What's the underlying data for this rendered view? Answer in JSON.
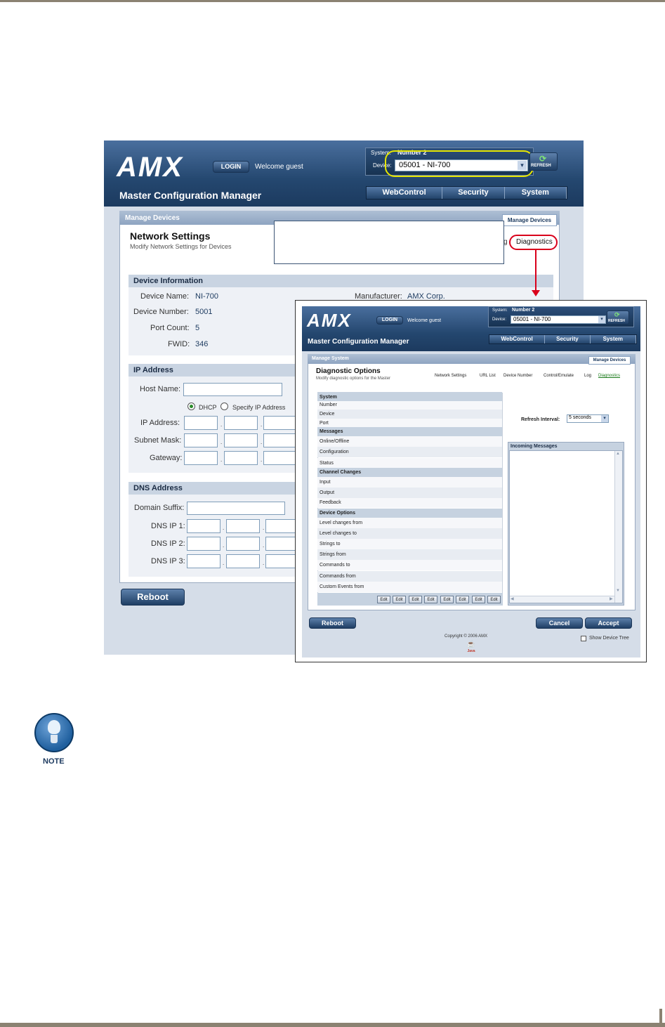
{
  "back": {
    "logo": "AMX",
    "login_label": "LOGIN",
    "welcome": "Welcome guest",
    "system_label": "System:",
    "system_value": "Number 2",
    "device_label": "Device:",
    "device_value": "05001 - NI-700",
    "refresh_label": "REFRESH",
    "app_title": "Master Configuration Manager",
    "tabs": [
      "WebControl",
      "Security",
      "System"
    ],
    "breadcrumb": "Manage Devices",
    "manage_tab": "Manage Devices",
    "page_title": "Network Settings",
    "page_subtitle": "Modify Network Settings for Devices",
    "nav_partial": "g",
    "nav_diagnostics": "Diagnostics",
    "device_info": {
      "section": "Device Information",
      "name_label": "Device Name:",
      "name": "NI-700",
      "number_label": "Device Number:",
      "number": "5001",
      "port_label": "Port Count:",
      "port": "5",
      "fwid_label": "FWID:",
      "fwid": "346",
      "mfr_label": "Manufacturer:",
      "mfr": "AMX Corp."
    },
    "ip": {
      "section": "IP Address",
      "host_label": "Host Name:",
      "dhcp": "DHCP",
      "specify": "Specify IP Address",
      "ip_label": "IP Address:",
      "subnet_label": "Subnet Mask:",
      "gateway_label": "Gateway:"
    },
    "dns": {
      "section": "DNS Address",
      "suffix_label": "Domain Suffix:",
      "dns1": "DNS IP 1:",
      "dns2": "DNS IP 2:",
      "dns3": "DNS IP 3:"
    },
    "reboot": "Reboot"
  },
  "front": {
    "logo": "AMX",
    "login_label": "LOGIN",
    "welcome": "Welcome guest",
    "system_label": "System:",
    "system_value": "Number 2",
    "device_label": "Device:",
    "device_value": "05001 - NI-700",
    "refresh_label": "REFRESH",
    "app_title": "Master Configuration Manager",
    "tabs": [
      "WebControl",
      "Security",
      "System"
    ],
    "breadcrumb": "Manage System",
    "manage_tab": "Manage Devices",
    "page_title": "Diagnostic Options",
    "page_subtitle": "Modify diagnostic options for the Master",
    "nav": [
      "Network Settings",
      "URL List",
      "Device Number",
      "Control/Emulate",
      "Log",
      "Diagnostics"
    ],
    "rows": [
      "System",
      "Number",
      "Device",
      "Port",
      "Messages",
      "Online/Offline",
      "Configuration",
      "Status",
      "Channel Changes",
      "Input",
      "Output",
      "Feedback",
      "Device Options",
      "Level changes from",
      "Level changes to",
      "Strings to",
      "Strings from",
      "Commands to",
      "Commands from",
      "Custom Events from"
    ],
    "edit_label": "Edit",
    "refresh_interval_label": "Refresh Interval:",
    "refresh_interval_value": "5 seconds",
    "incoming_label": "Incoming Messages",
    "reboot": "Reboot",
    "cancel": "Cancel",
    "accept": "Accept",
    "copyright": "Copyright © 2006 AMX",
    "show_tree": "Show Device Tree",
    "java_label": "Java"
  },
  "note_label": "NOTE",
  "colors": {
    "header": "#24476f",
    "panel": "#eef1f6",
    "highlight_yellow": "#e6e600",
    "highlight_red": "#d9001b"
  }
}
